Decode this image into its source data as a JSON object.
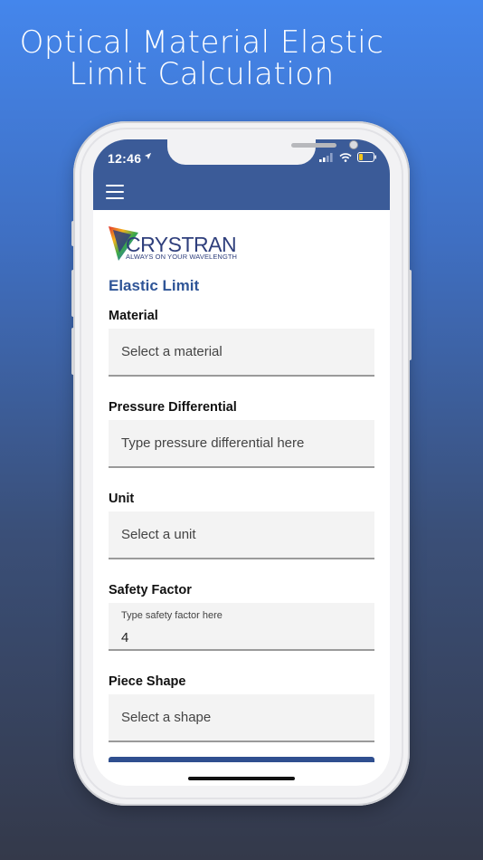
{
  "headline": {
    "line1": "Optical Material Elastic",
    "line2": "Limit Calculation"
  },
  "status_bar": {
    "time": "12:46"
  },
  "logo": {
    "word": "CRYSTRAN",
    "tagline": "ALWAYS ON YOUR WAVELENGTH"
  },
  "form": {
    "title": "Elastic Limit",
    "fields": [
      {
        "label": "Material",
        "placeholder": "Select a material",
        "value": ""
      },
      {
        "label": "Pressure Differential",
        "placeholder": "Type pressure differential here",
        "value": ""
      },
      {
        "label": "Unit",
        "placeholder": "Select a unit",
        "value": ""
      },
      {
        "label": "Safety Factor",
        "placeholder": "Type safety factor here",
        "value": "4"
      },
      {
        "label": "Piece Shape",
        "placeholder": "Select a shape",
        "value": ""
      }
    ]
  },
  "colors": {
    "appbar": "#3b5b98",
    "title": "#2f5597",
    "background_top": "#4486ec",
    "background_bottom": "#34394a"
  }
}
